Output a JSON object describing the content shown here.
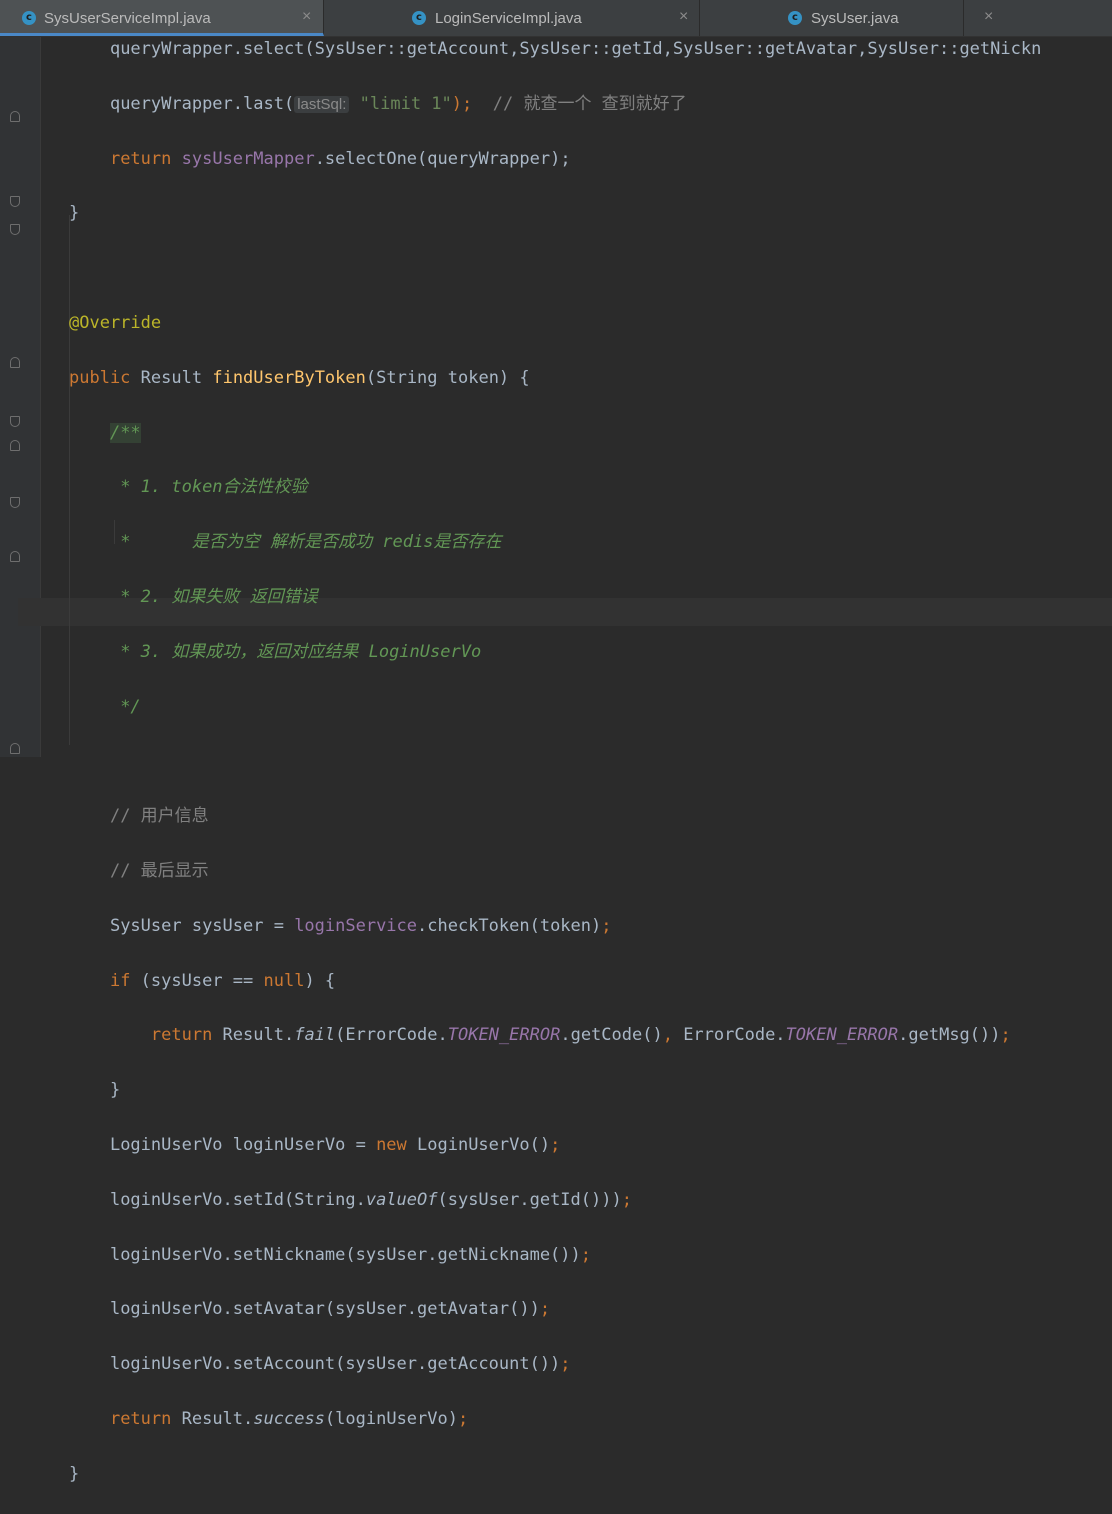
{
  "tabs": [
    {
      "label": "SysUserServiceImpl.java",
      "icon": "class-icon",
      "active": true
    },
    {
      "label": "LoginServiceImpl.java",
      "icon": "class-icon",
      "active": false
    },
    {
      "label": "SysUser.java",
      "icon": "class-icon",
      "active": false
    }
  ],
  "tab_icon_letter": "c",
  "close_glyph": "×",
  "colors": {
    "background": "#2b2b2b",
    "keyword": "#cc7832",
    "field": "#9876aa",
    "method": "#ffc66d",
    "string": "#6a8759",
    "annotation": "#bbb529",
    "comment": "#808080",
    "doc_comment": "#629755",
    "tab_accent": "#4a88c7"
  },
  "code": {
    "l0": "queryWrapper.select(SysUser::getAccount,SysUser::getId,SysUser::getAvatar,SysUser::getNickn",
    "l1_a": "queryWrapper.last(",
    "l1_hint": "lastSql:",
    "l1_str": "\"limit 1\"",
    "l1_semi": ");",
    "l1_cmt": "// 就查一个 查到就好了",
    "l2_kw": "return",
    "l2_fld": "sysUserMapper",
    "l2_rest": ".selectOne(queryWrapper);",
    "l3": "}",
    "l5": "@Override",
    "l6_kw": "public",
    "l6_type": "Result",
    "l6_mth": "findUserByToken",
    "l6_rest": "(String token) {",
    "l7": "/**",
    "l8": " * 1. token合法性校验",
    "l9": " *      是否为空 解析是否成功 redis是否存在",
    "l10": " * 2. 如果失败 返回错误",
    "l11": " * 3. 如果成功，返回对应结果 LoginUserVo",
    "l12": " */",
    "l14": "// 用户信息",
    "l15": "// 最后显示",
    "l16_a": "SysUser sysUser = ",
    "l16_fld": "loginService",
    "l16_b": ".checkToken(token)",
    "l16_semi": ";",
    "l17_kw": "if",
    "l17_a": " (sysUser == ",
    "l17_null": "null",
    "l17_b": ") {",
    "l18_kw": "return",
    "l18_a": " Result.",
    "l18_it": "fail",
    "l18_b": "(ErrorCode.",
    "l18_c1": "TOKEN_ERROR",
    "l18_c": ".getCode()",
    "l18_comma": ",",
    "l18_d": " ErrorCode.",
    "l18_c2": "TOKEN_ERROR",
    "l18_e": ".getMsg())",
    "l18_semi": ";",
    "l19": "}",
    "l20_a": "LoginUserVo loginUserVo = ",
    "l20_kw": "new",
    "l20_b": " LoginUserVo()",
    "l20_semi": ";",
    "l21_a": "loginUserVo.setId(String.",
    "l21_it": "valueOf",
    "l21_b": "(sysUser.getId()))",
    "l21_semi": ";",
    "l22_a": "loginUserVo.setNickname(sysUser.getNickname())",
    "l22_semi": ";",
    "l23_a": "loginUserVo.setAvatar(sysUser.getAvatar())",
    "l23_semi": ";",
    "l24_a": "loginUserVo.setAccount(sysUser.getAccount())",
    "l24_semi": ";",
    "l25_kw": "return",
    "l25_a": " Result.",
    "l25_it": "success",
    "l25_b": "(loginUserVo)",
    "l25_semi": ";",
    "l26": "}"
  }
}
